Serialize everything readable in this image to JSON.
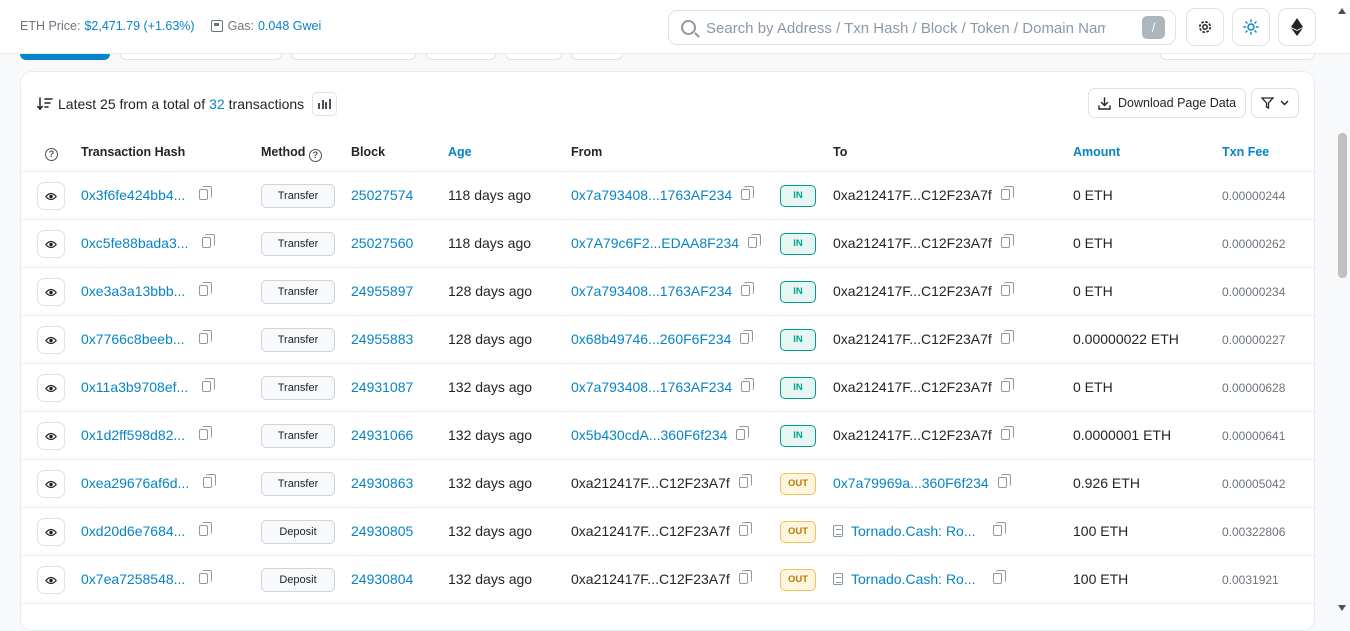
{
  "header": {
    "eth_price_label": "ETH Price:",
    "eth_price_value": "$2,471.79 (+1.63%)",
    "gas_label": "Gas:",
    "gas_value": "0.048 Gwei",
    "search_placeholder": "Search by Address / Txn Hash / Block / Token / Domain Name",
    "search_shortcut": "/",
    "icons": [
      "settings-gear-icon",
      "theme-sun-icon",
      "ethereum-logo-icon"
    ]
  },
  "summary": {
    "prefix": "Latest 25 from a total of",
    "total": "32",
    "suffix": "transactions",
    "download_label": "Download Page Data"
  },
  "columns": {
    "hash": "Transaction Hash",
    "method": "Method",
    "block": "Block",
    "age": "Age",
    "from": "From",
    "to": "To",
    "amount": "Amount",
    "fee": "Txn Fee"
  },
  "rows": [
    {
      "hash": "0x3f6fe424bb4...",
      "method": "Transfer",
      "block": "25027574",
      "age": "118 days ago",
      "from": "0x7a793408...1763AF234",
      "from_link": true,
      "dir": "IN",
      "to": "0xa212417F...C12F23A7f",
      "to_link": false,
      "to_contract": false,
      "amount": "0 ETH",
      "fee": "0.00000244"
    },
    {
      "hash": "0xc5fe88bada3...",
      "method": "Transfer",
      "block": "25027560",
      "age": "118 days ago",
      "from": "0x7A79c6F2...EDAA8F234",
      "from_link": true,
      "dir": "IN",
      "to": "0xa212417F...C12F23A7f",
      "to_link": false,
      "to_contract": false,
      "amount": "0 ETH",
      "fee": "0.00000262"
    },
    {
      "hash": "0xe3a3a13bbb...",
      "method": "Transfer",
      "block": "24955897",
      "age": "128 days ago",
      "from": "0x7a793408...1763AF234",
      "from_link": true,
      "dir": "IN",
      "to": "0xa212417F...C12F23A7f",
      "to_link": false,
      "to_contract": false,
      "amount": "0 ETH",
      "fee": "0.00000234"
    },
    {
      "hash": "0x7766c8beeb...",
      "method": "Transfer",
      "block": "24955883",
      "age": "128 days ago",
      "from": "0x68b49746...260F6F234",
      "from_link": true,
      "dir": "IN",
      "to": "0xa212417F...C12F23A7f",
      "to_link": false,
      "to_contract": false,
      "amount": "0.00000022 ETH",
      "fee": "0.00000227"
    },
    {
      "hash": "0x11a3b9708ef...",
      "method": "Transfer",
      "block": "24931087",
      "age": "132 days ago",
      "from": "0x7a793408...1763AF234",
      "from_link": true,
      "dir": "IN",
      "to": "0xa212417F...C12F23A7f",
      "to_link": false,
      "to_contract": false,
      "amount": "0 ETH",
      "fee": "0.00000628"
    },
    {
      "hash": "0x1d2ff598d82...",
      "method": "Transfer",
      "block": "24931066",
      "age": "132 days ago",
      "from": "0x5b430cdA...360F6f234",
      "from_link": true,
      "dir": "IN",
      "to": "0xa212417F...C12F23A7f",
      "to_link": false,
      "to_contract": false,
      "amount": "0.0000001 ETH",
      "fee": "0.00000641"
    },
    {
      "hash": "0xea29676af6d...",
      "method": "Transfer",
      "block": "24930863",
      "age": "132 days ago",
      "from": "0xa212417F...C12F23A7f",
      "from_link": false,
      "dir": "OUT",
      "to": "0x7a79969a...360F6f234",
      "to_link": true,
      "to_contract": false,
      "amount": "0.926 ETH",
      "fee": "0.00005042"
    },
    {
      "hash": "0xd20d6e7684...",
      "method": "Deposit",
      "block": "24930805",
      "age": "132 days ago",
      "from": "0xa212417F...C12F23A7f",
      "from_link": false,
      "dir": "OUT",
      "to": "Tornado.Cash: Ro...",
      "to_link": true,
      "to_contract": true,
      "amount": "100 ETH",
      "fee": "0.00322806"
    },
    {
      "hash": "0x7ea7258548...",
      "method": "Deposit",
      "block": "24930804",
      "age": "132 days ago",
      "from": "0xa212417F...C12F23A7f",
      "from_link": false,
      "dir": "OUT",
      "to": "Tornado.Cash: Ro...",
      "to_link": true,
      "to_contract": true,
      "amount": "100 ETH",
      "fee": "0.0031921"
    }
  ],
  "colors": {
    "link": "#0784c3",
    "in_badge": "#00a186",
    "out_badge": "#b47d00"
  }
}
